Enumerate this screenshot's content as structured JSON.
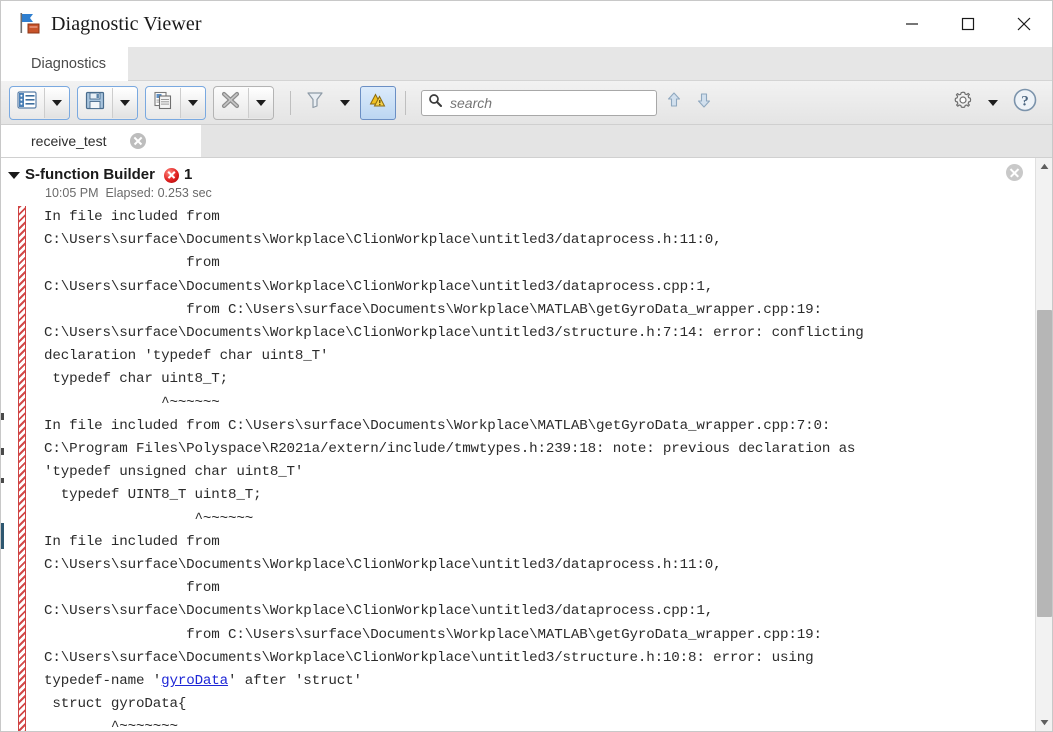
{
  "window": {
    "title": "Diagnostic Viewer",
    "app_icon": "diagnostic-viewer-icon",
    "controls": {
      "minimize": "—",
      "maximize": "□",
      "close": "✕"
    }
  },
  "toolstrip": {
    "tabs": [
      {
        "label": "Diagnostics",
        "active": true
      }
    ]
  },
  "toolbar": {
    "buttons": [
      {
        "name": "view-options-button",
        "icon": "list-view-icon",
        "has_dropdown": true,
        "highlighted": true
      },
      {
        "name": "save-button",
        "icon": "save-floppy-icon",
        "has_dropdown": true,
        "highlighted": true
      },
      {
        "name": "copy-button",
        "icon": "copy-pages-icon",
        "has_dropdown": true,
        "highlighted": true
      },
      {
        "name": "clear-button",
        "icon": "clear-x-icon",
        "has_dropdown": true,
        "highlighted": false
      },
      {
        "name": "filter-button",
        "icon": "filter-funnel-icon",
        "has_dropdown": true
      },
      {
        "name": "warnings-toggle-button",
        "icon": "warning-triangles-icon",
        "active": true
      }
    ],
    "search": {
      "placeholder": "search",
      "value": "",
      "icon": "search-icon"
    },
    "nav": {
      "previous": "up-arrow-icon",
      "next": "down-arrow-icon"
    },
    "right": {
      "settings": "gear-icon",
      "settings_dropdown": "chevron-down-icon",
      "help": "help-question-icon"
    }
  },
  "document_tabs": [
    {
      "label": "receive_test",
      "active": true,
      "closable": true
    }
  ],
  "message": {
    "title": "S-function Builder",
    "severity_icon": "error-badge-icon",
    "count": "1",
    "timestamp": "10:05 PM",
    "elapsed": "Elapsed: 0.253 sec",
    "expanded": true,
    "close_icon": "close-circle-icon",
    "lines": [
      {
        "text": "In file included from"
      },
      {
        "text": "C:\\Users\\surface\\Documents\\Workplace\\ClionWorkplace\\untitled3/dataprocess.h:11:0,"
      },
      {
        "text": "                 from"
      },
      {
        "text": "C:\\Users\\surface\\Documents\\Workplace\\ClionWorkplace\\untitled3/dataprocess.cpp:1,"
      },
      {
        "text": "                 from C:\\Users\\surface\\Documents\\Workplace\\MATLAB\\getGyroData_wrapper.cpp:19:"
      },
      {
        "text": "C:\\Users\\surface\\Documents\\Workplace\\ClionWorkplace\\untitled3/structure.h:7:14: error: conflicting"
      },
      {
        "text": "declaration 'typedef char uint8_T'"
      },
      {
        "text": " typedef char uint8_T;"
      },
      {
        "text": "              ^~~~~~~"
      },
      {
        "text": "In file included from C:\\Users\\surface\\Documents\\Workplace\\MATLAB\\getGyroData_wrapper.cpp:7:0:"
      },
      {
        "text": "C:\\Program Files\\Polyspace\\R2021a/extern/include/tmwtypes.h:239:18: note: previous declaration as"
      },
      {
        "text": "'typedef unsigned char uint8_T'"
      },
      {
        "text": "  typedef UINT8_T uint8_T;"
      },
      {
        "text": "                  ^~~~~~~"
      },
      {
        "text": "In file included from"
      },
      {
        "text": "C:\\Users\\surface\\Documents\\Workplace\\ClionWorkplace\\untitled3/dataprocess.h:11:0,"
      },
      {
        "text": "                 from"
      },
      {
        "text": "C:\\Users\\surface\\Documents\\Workplace\\ClionWorkplace\\untitled3/dataprocess.cpp:1,"
      },
      {
        "text": "                 from C:\\Users\\surface\\Documents\\Workplace\\MATLAB\\getGyroData_wrapper.cpp:19:"
      },
      {
        "text": "C:\\Users\\surface\\Documents\\Workplace\\ClionWorkplace\\untitled3/structure.h:10:8: error: using"
      },
      {
        "text": "typedef-name '",
        "link": "gyroData",
        "text_after": "' after 'struct'"
      },
      {
        "text": " struct gyroData{"
      },
      {
        "text": "        ^~~~~~~~"
      }
    ]
  },
  "scrollbar": {
    "up_icon": "scroll-up-arrow-icon",
    "down_icon": "scroll-down-arrow-icon",
    "thumb_top_pct": 25,
    "thumb_height_pct": 57
  },
  "colors": {
    "error_red": "#d24a4a",
    "link_blue": "#1d26d6",
    "toolbar_bg": "#ebebeb",
    "accent_blue": "#7aa9e0"
  }
}
